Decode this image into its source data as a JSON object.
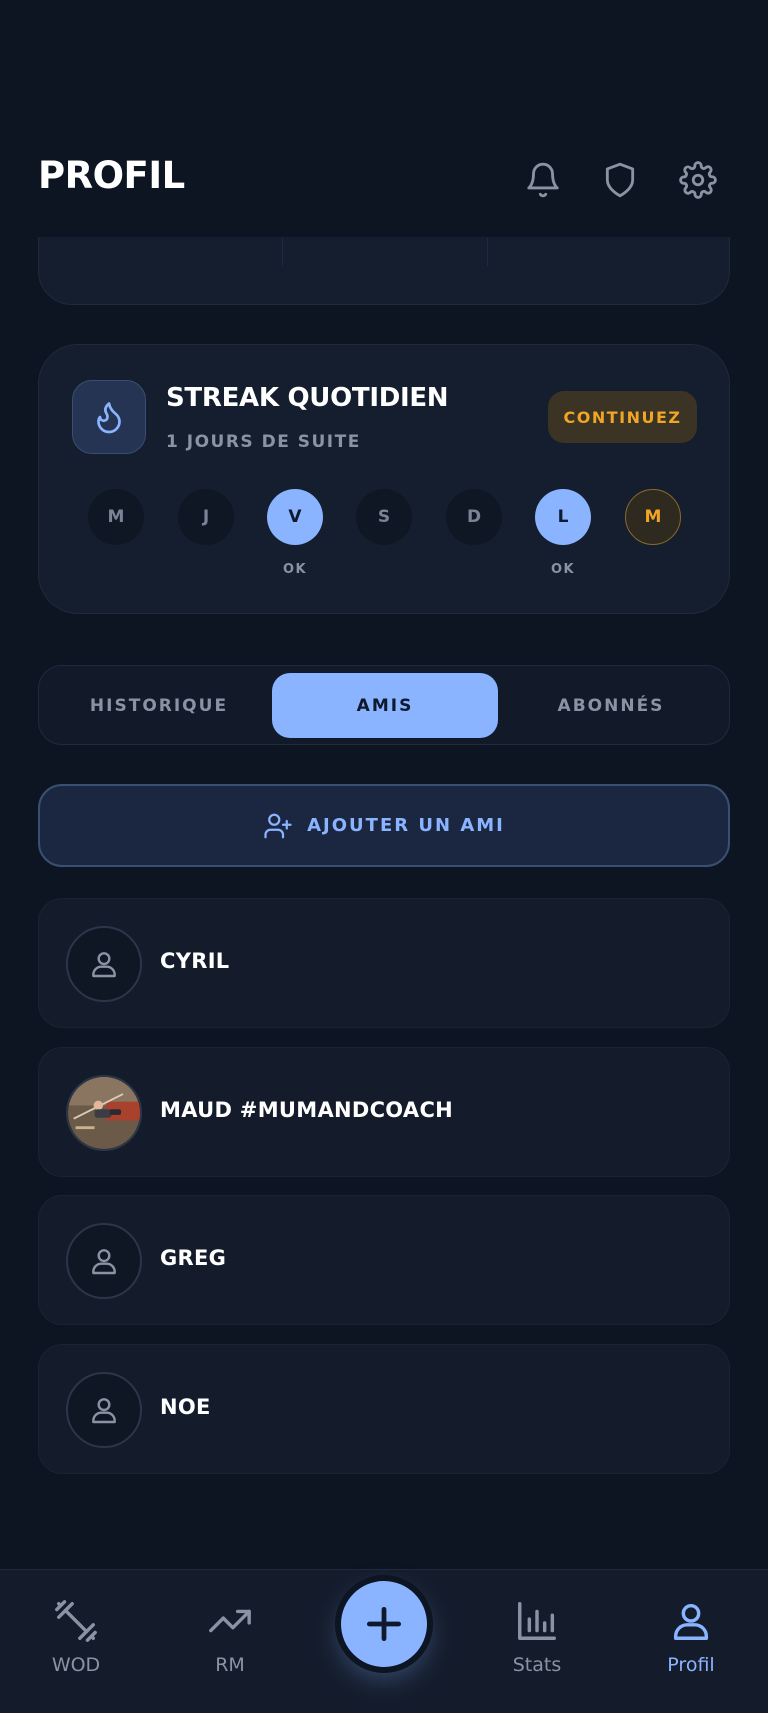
{
  "header": {
    "title": "PROFIL",
    "icons": [
      "bell-icon",
      "shield-icon",
      "gear-icon"
    ]
  },
  "streak": {
    "icon": "flame-icon",
    "title": "STREAK QUOTIDIEN",
    "subtitle": "1 JOURS DE SUITE",
    "continue_label": "CONTINUEZ",
    "days": [
      {
        "letter": "M",
        "status": "missed",
        "label": ""
      },
      {
        "letter": "J",
        "status": "missed",
        "label": ""
      },
      {
        "letter": "V",
        "status": "done",
        "label": "OK"
      },
      {
        "letter": "S",
        "status": "missed",
        "label": ""
      },
      {
        "letter": "D",
        "status": "missed",
        "label": ""
      },
      {
        "letter": "L",
        "status": "done",
        "label": "OK"
      },
      {
        "letter": "M",
        "status": "today",
        "label": ""
      }
    ]
  },
  "tabs": [
    {
      "label": "HISTORIQUE",
      "active": false
    },
    {
      "label": "AMIS",
      "active": true
    },
    {
      "label": "ABONNÉS",
      "active": false
    }
  ],
  "add_friend": {
    "label": "AJOUTER UN AMI",
    "icon": "user-plus-icon"
  },
  "friends": [
    {
      "name": "CYRIL",
      "avatar": "default"
    },
    {
      "name": "MAUD #MUMANDCOACH",
      "avatar": "photo"
    },
    {
      "name": "GREG",
      "avatar": "default"
    },
    {
      "name": "NOE",
      "avatar": "default"
    }
  ],
  "nav": {
    "items": [
      {
        "label": "WOD",
        "icon": "dumbbell-icon",
        "active": false
      },
      {
        "label": "RM",
        "icon": "trending-up-icon",
        "active": false
      },
      {
        "label": "Stats",
        "icon": "bar-chart-icon",
        "active": false
      },
      {
        "label": "Profil",
        "icon": "user-icon",
        "active": true
      }
    ],
    "fab_icon": "plus-icon"
  },
  "colors": {
    "background": "#0d1422",
    "card": "#151e2f",
    "accent": "#8ab4ff",
    "warning": "#f0a526",
    "muted": "#8a93a4"
  }
}
